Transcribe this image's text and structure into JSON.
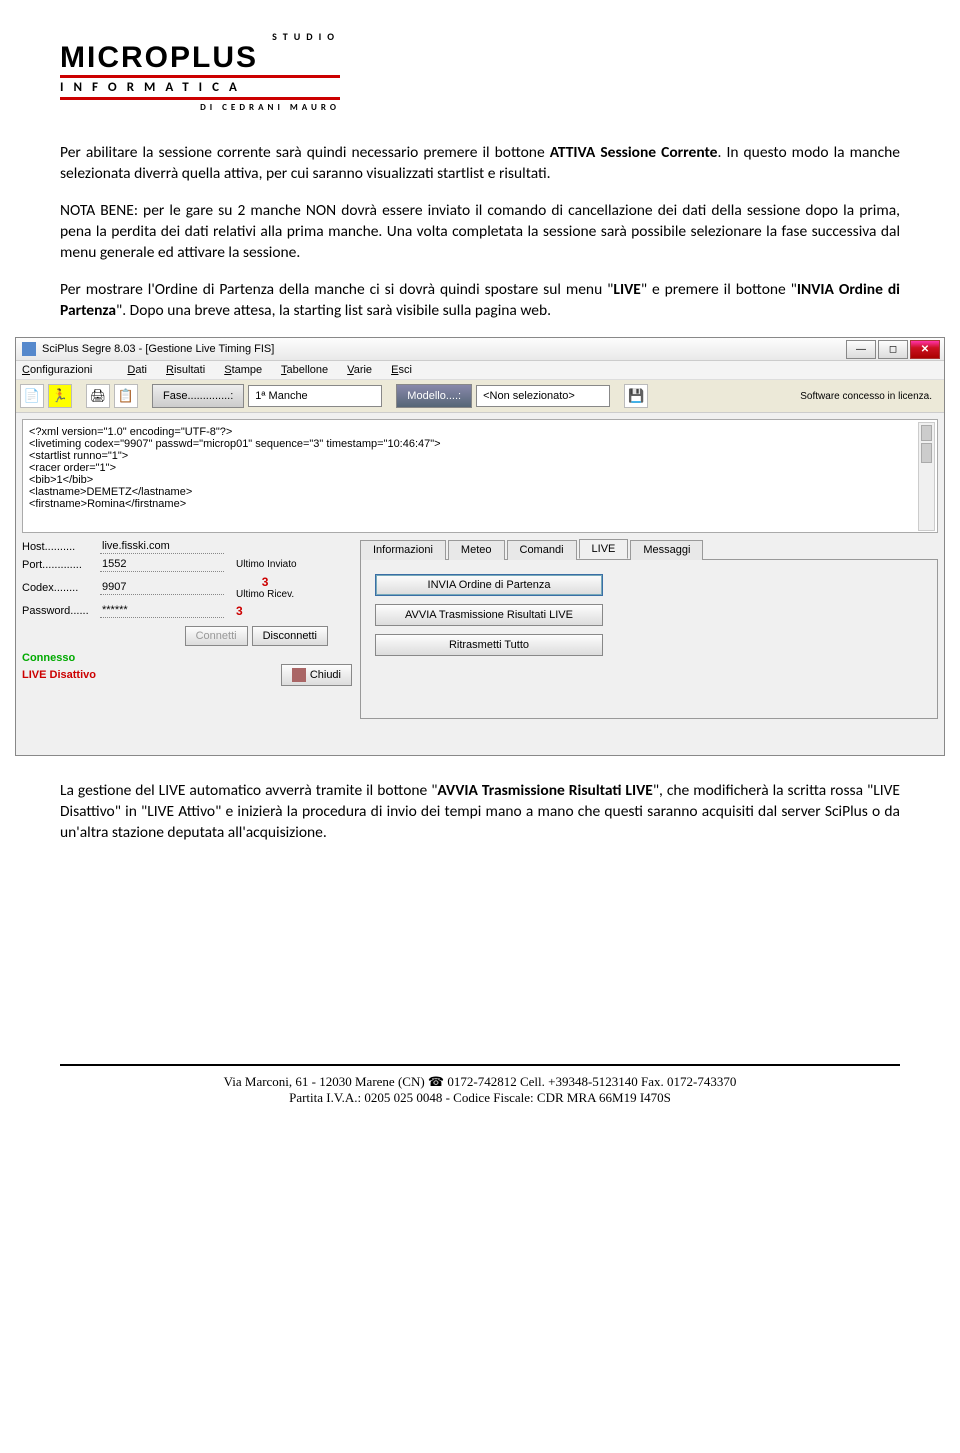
{
  "logo": {
    "studio": "STUDIO",
    "name": "MICROPLUS",
    "informatica": "INFORMATICA",
    "cedrani": "DI CEDRANI MAURO"
  },
  "paras": {
    "p1_a": "Per abilitare la sessione corrente sarà quindi necessario premere il bottone ",
    "p1_b": "ATTIVA Sessione Corrente",
    "p1_c": ". In questo modo la manche selezionata diverrà quella attiva, per cui saranno visualizzati startlist e risultati.",
    "p2_a": "NOTA BENE: per le gare su 2 manche NON dovrà essere inviato il comando di cancellazione dei dati della sessione dopo la prima, pena la perdita dei dati relativi alla prima manche. Una volta completata la sessione sarà possibile selezionare la fase successiva dal menu generale ed attivare la sessione.",
    "p3_a": "Per mostrare l'Ordine di Partenza della manche ci si dovrà quindi spostare sul menu \"",
    "p3_b": "LIVE",
    "p3_c": "\" e premere il bottone \"",
    "p3_d": "INVIA Ordine di Partenza",
    "p3_e": "\". Dopo una breve attesa, la starting list sarà visibile sulla pagina web.",
    "p4_a": "La gestione del LIVE automatico avverrà tramite il bottone \"",
    "p4_b": "AVVIA Trasmissione Risultati LIVE",
    "p4_c": "\", che modificherà la scritta rossa \"LIVE Disattivo\" in \"LIVE Attivo\" e inizierà la procedura di invio dei tempi mano a mano che questi saranno acquisiti dal server SciPlus o da un'altra stazione deputata all'acquisizione."
  },
  "app": {
    "title": "SciPlus Segre 8.03 - [Gestione Live Timing FIS]",
    "menu": {
      "configurazioni": "Configurazioni",
      "dati": "Dati",
      "risultati": "Risultati",
      "stampe": "Stampe",
      "tabellone": "Tabellone",
      "varie": "Varie",
      "esci": "Esci"
    },
    "fase_label": "Fase..............:",
    "fase_value": "1ª Manche",
    "modello_label": "Modello....:",
    "modello_value": "<Non selezionato>",
    "license": "Software concesso in licenza.",
    "xml": "<?xml version=\"1.0\" encoding=\"UTF-8\"?>\n<livetiming codex=\"9907\" passwd=\"microp01\" sequence=\"3\" timestamp=\"10:46:47\">\n<startlist runno=\"1\">\n<racer order=\"1\">\n<bib>1</bib>\n<lastname>DEMETZ</lastname>\n<firstname>Romina</firstname>",
    "conn": {
      "host_label": "Host..........",
      "host_value": "live.fisski.com",
      "port_label": "Port.............",
      "port_value": "1552",
      "codex_label": "Codex........",
      "codex_value": "9907",
      "password_label": "Password......",
      "password_value": "******",
      "ultimo_inviato_label": "Ultimo Inviato",
      "ultimo_inviato_num": "3",
      "ultimo_ricev_label": "Ultimo Ricev.",
      "ultimo_ricev_num": "3",
      "connetti": "Connetti",
      "disconnetti": "Disconnetti",
      "connesso": "Connesso",
      "live_disattivo": "LIVE Disattivo",
      "chiudi": "Chiudi"
    },
    "tabs": {
      "informazioni": "Informazioni",
      "meteo": "Meteo",
      "comandi": "Comandi",
      "live": "LIVE",
      "messaggi": "Messaggi"
    },
    "live_buttons": {
      "invia": "INVIA Ordine di Partenza",
      "avvia": "AVVIA Trasmissione Risultati LIVE",
      "ritrasmetti": "Ritrasmetti Tutto"
    }
  },
  "footer": {
    "line1_a": "Via Marconi, 61 - 12030 Marene (CN) ",
    "line1_b": " 0172-742812 Cell. +39348-5123140 Fax. 0172-743370",
    "line2": "Partita I.V.A.: 0205 025 0048 - Codice Fiscale: CDR MRA 66M19 I470S"
  }
}
